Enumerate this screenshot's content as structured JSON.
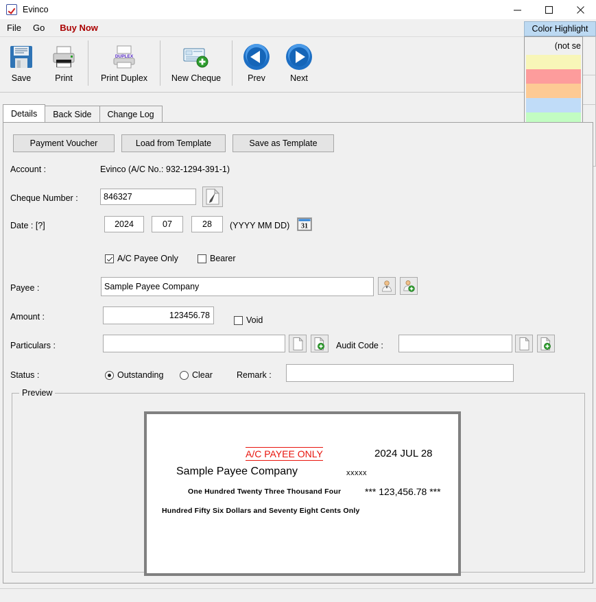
{
  "window": {
    "title": "Evinco",
    "icon": "app-checkbox-icon",
    "minimize": "–",
    "maximize": "□",
    "close": "✕"
  },
  "menubar": {
    "items": [
      {
        "label": "File",
        "name": "menu-file"
      },
      {
        "label": "Go",
        "name": "menu-go"
      },
      {
        "label": "Buy Now",
        "name": "menu-buy-now",
        "accent": "#aa0000"
      }
    ]
  },
  "toolbar": {
    "items": [
      {
        "label": "Save",
        "icon": "floppy-disk-icon"
      },
      {
        "label": "Print",
        "icon": "printer-icon"
      },
      {
        "label": "Print Duplex",
        "icon": "printer-duplex-icon"
      },
      {
        "label": "New Cheque",
        "icon": "new-cheque-icon"
      },
      {
        "label": "Prev",
        "icon": "arrow-left-circle-icon"
      },
      {
        "label": "Next",
        "icon": "arrow-right-circle-icon"
      }
    ],
    "duplex_badge": "DUPLEX"
  },
  "color_highlight": {
    "header": "Color Highlight",
    "not_selected": "(not se",
    "swatches": [
      "#f8f6b8",
      "#fd9c9c",
      "#fdca94",
      "#c0dcf8",
      "#c2fdc2",
      "#7a4b8e",
      "#8c3a08",
      "#76767f"
    ]
  },
  "tabs": [
    {
      "label": "Details",
      "active": true
    },
    {
      "label": "Back Side",
      "active": false
    },
    {
      "label": "Change Log",
      "active": false
    }
  ],
  "template_buttons": {
    "payment_voucher": "Payment Voucher",
    "load_from_template": "Load from Template",
    "save_as_template": "Save as Template"
  },
  "form": {
    "account_label": "Account :",
    "account_value": "Evinco (A/C No.: 932-1294-391-1)",
    "cheque_number_label": "Cheque Number :",
    "cheque_number_value": "846327",
    "cheque_number_edit_icon": "page-pen-icon",
    "void_label": "Void",
    "void_checked": false,
    "date_label": "Date : [?]",
    "date_year": "2024",
    "date_month": "07",
    "date_day": "28",
    "date_format_hint": "(YYYY MM DD)",
    "calendar_icon": "calendar-31-icon",
    "ac_payee_only_label": "A/C Payee Only",
    "ac_payee_only_checked": true,
    "bearer_label": "Bearer",
    "bearer_checked": false,
    "payee_label": "Payee :",
    "payee_value": "Sample Payee Company",
    "payee_select_icon": "person-icon",
    "payee_add_icon": "person-add-icon",
    "amount_label": "Amount :",
    "amount_value": "123456.78",
    "particulars_label": "Particulars :",
    "particulars_value": "",
    "particulars_doc_icon": "document-icon",
    "particulars_add_icon": "document-add-icon",
    "audit_code_label": "Audit Code :",
    "audit_code_value": "",
    "audit_doc_icon": "document-icon",
    "audit_add_icon": "document-add-icon",
    "status_label": "Status :",
    "status_outstanding": "Outstanding",
    "status_clear": "Clear",
    "status_selected": "Outstanding",
    "remark_label": "Remark :",
    "remark_value": ""
  },
  "preview": {
    "group_title": "Preview",
    "ac_payee_only": "A/C PAYEE ONLY",
    "date": "2024 JUL 28",
    "payee": "Sample Payee Company",
    "xxxxx": "xxxxx",
    "amount_words_line1": "One Hundred Twenty Three Thousand Four",
    "amount_words_line2": "Hundred Fifty Six Dollars and Seventy Eight Cents Only",
    "amount_figures": "*** 123,456.78 ***"
  }
}
